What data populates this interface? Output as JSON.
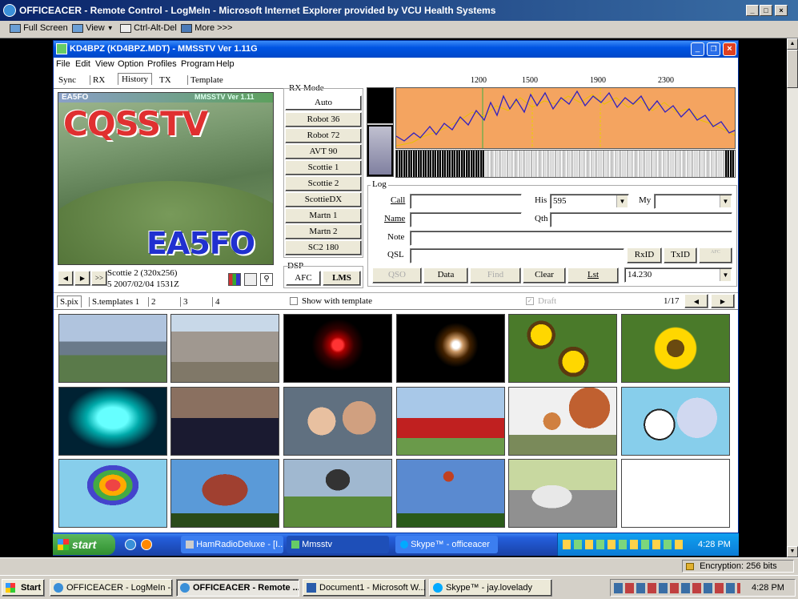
{
  "ie": {
    "title": "OFFICEACER - Remote Control - LogMeIn - Microsoft Internet Explorer provided by VCU Health Systems",
    "toolbar": {
      "fullscreen": "Full Screen",
      "view": "View",
      "ctrl_alt_del": "Ctrl-Alt-Del",
      "more": "More >>>"
    },
    "status_encryption": "Encryption: 256 bits"
  },
  "mmsstv": {
    "title": "KD4BPZ (KD4BPZ.MDT) - MMSSTV Ver 1.11G",
    "menu": [
      "File",
      "Edit",
      "View",
      "Option",
      "Profiles",
      "Program",
      "Help"
    ],
    "tabs": [
      "Sync",
      "RX",
      "History",
      "TX",
      "Template"
    ],
    "image": {
      "top_left": "EA5FO",
      "top_right": "MMSSTV Ver 1.11",
      "big_text": "CQSSTV",
      "call": "EA5FO"
    },
    "rx_info_line1": "Scottie 2 (320x256)",
    "rx_info_line2": "5 2007/02/04 1531Z",
    "rx_mode_label": "RX Mode",
    "rx_modes": [
      "Auto",
      "Robot 36",
      "Robot 72",
      "AVT 90",
      "Scottie 1",
      "Scottie 2",
      "ScottieDX",
      "Martn 1",
      "Martn 2",
      "SC2 180"
    ],
    "dsp_label": "DSP",
    "dsp_afc": "AFC",
    "dsp_lms": "LMS",
    "spectrum_ticks": [
      "1200",
      "1500",
      "1900",
      "2300"
    ],
    "log": {
      "label": "Log",
      "call_label": "Call",
      "call_value": "",
      "his_label": "His",
      "his_value": "595",
      "my_label": "My",
      "my_value": "",
      "name_label": "Name",
      "name_value": "",
      "qth_label": "Qth",
      "qth_value": "",
      "note_label": "Note",
      "note_value": "",
      "qsl_label": "QSL",
      "qsl_value": "",
      "rxid": "RxID",
      "txid": "TxID",
      "afc_small": "AFC",
      "qso": "QSO",
      "data": "Data",
      "find": "Find",
      "clear": "Clear",
      "list": "Lst",
      "freq": "14.230"
    },
    "lower_tabs": [
      "S.pix",
      "S.templates 1",
      "2",
      "3",
      "4"
    ],
    "show_template": "Show with template",
    "draft": "Draft",
    "page": "1/17"
  },
  "remote_taskbar": {
    "start": "start",
    "items": [
      "HamRadioDeluxe - [I...",
      "Mmsstv",
      "Skype™ - officeacer"
    ],
    "clock": "4:28 PM"
  },
  "local_taskbar": {
    "start": "Start",
    "items": [
      "OFFICEACER - LogMeIn -...",
      "OFFICEACER - Remote ...",
      "Document1 - Microsoft W...",
      "Skype™ - jay.lovelady"
    ],
    "clock": "4:28 PM"
  },
  "colors": {
    "accent_blue": "#0a246a",
    "xp_title": "#0054e3",
    "spectrum_bg": "#f4a460"
  }
}
